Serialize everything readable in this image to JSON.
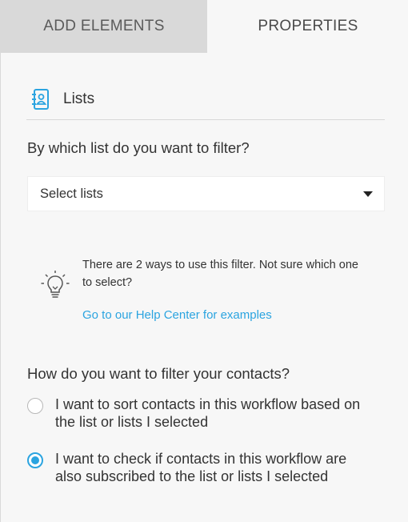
{
  "tabs": {
    "add_elements": "ADD ELEMENTS",
    "properties": "PROPERTIES",
    "active": "properties"
  },
  "section": {
    "icon": "contact-book-icon",
    "title": "Lists"
  },
  "list_filter": {
    "question": "By which list do you want to filter?",
    "select_value": "Select lists"
  },
  "tip": {
    "icon": "lightbulb-icon",
    "text": "There are 2 ways to use this filter. Not sure which one to select?",
    "link": "Go to our Help Center for examples"
  },
  "contacts_filter": {
    "question": "How do you want to filter your contacts?",
    "options": [
      {
        "label": "I want to sort contacts in this workflow based on the list or lists I selected",
        "selected": false
      },
      {
        "label": "I want to check if contacts in this workflow are also subscribed to the list or lists I selected",
        "selected": true
      }
    ]
  },
  "colors": {
    "accent": "#2ba4e0",
    "inactive_tab": "#d9d9d9",
    "panel_bg": "#f7f7f7"
  }
}
